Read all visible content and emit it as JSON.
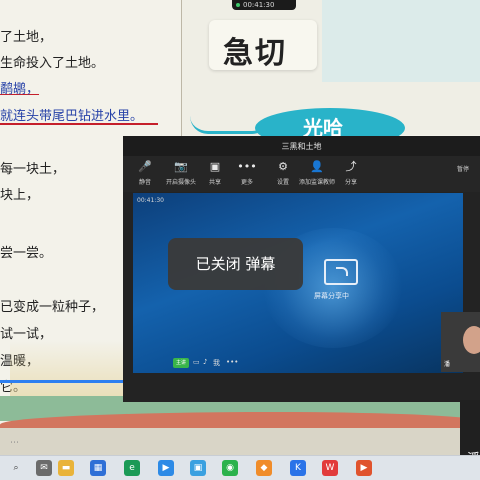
{
  "slide": {
    "lines": [
      "了土地，",
      "生命投入了土地。",
      "鹬鹕，",
      "就连头带尾巴钻进水里。",
      "每一块土，",
      "块上，",
      "尝一尝。",
      "已变成一粒种子，",
      "试一试，",
      "温暖，",
      "它。"
    ],
    "title": "急切",
    "bubble_text": "光哈"
  },
  "top_time": "00:41:30",
  "meeting": {
    "title": "三黑和土地",
    "toolbar": [
      {
        "icon": "microphone-icon",
        "glyph": "🎤",
        "label": "静音"
      },
      {
        "icon": "camera-icon",
        "glyph": "📷",
        "label": "开启摄像头"
      },
      {
        "icon": "share-screen-icon",
        "glyph": "▣",
        "label": "共享"
      },
      {
        "icon": "more-icon",
        "glyph": "•••",
        "label": "更多"
      },
      {
        "icon": "settings-icon",
        "glyph": "⚙",
        "label": "设置"
      },
      {
        "icon": "add-participant-icon",
        "glyph": "👤",
        "label": "添加监课教师"
      },
      {
        "icon": "share-icon",
        "glyph": "⤴",
        "label": "分享"
      }
    ],
    "far_right_label": "暂停",
    "screen_clock": "00:41:30",
    "share_label": "屏幕分享中",
    "bottom_chip": "主讲",
    "bottom_name": "我",
    "tile_name": "潘"
  },
  "toast": "已关闭 弹幕",
  "video": {
    "progress": 0.5
  },
  "corner_char": "潘",
  "taskbar": [
    {
      "icon": "search-icon",
      "glyph": "⌕",
      "color": "#3a3a3a"
    },
    {
      "icon": "mail-icon",
      "glyph": "✉",
      "color": "#6b6b6b"
    },
    {
      "icon": "folder-icon",
      "glyph": "▬",
      "color": "#e9b33a"
    },
    {
      "icon": "windows-store-icon",
      "glyph": "▦",
      "color": "#2f6fd6"
    },
    {
      "icon": "edge-icon",
      "glyph": "e",
      "color": "#1b9a56"
    },
    {
      "icon": "app-blue-icon",
      "glyph": "▶",
      "color": "#2d8ae6"
    },
    {
      "icon": "photos-icon",
      "glyph": "▣",
      "color": "#3aa0e0"
    },
    {
      "icon": "wechat-icon",
      "glyph": "◉",
      "color": "#2bb24c"
    },
    {
      "icon": "app-orange-icon",
      "glyph": "◆",
      "color": "#f08c2a"
    },
    {
      "icon": "kugou-icon",
      "glyph": "K",
      "color": "#2a73e8"
    },
    {
      "icon": "wps-icon",
      "glyph": "W",
      "color": "#e23b3b"
    },
    {
      "icon": "video-app-icon",
      "glyph": "▶",
      "color": "#e0532d"
    }
  ]
}
